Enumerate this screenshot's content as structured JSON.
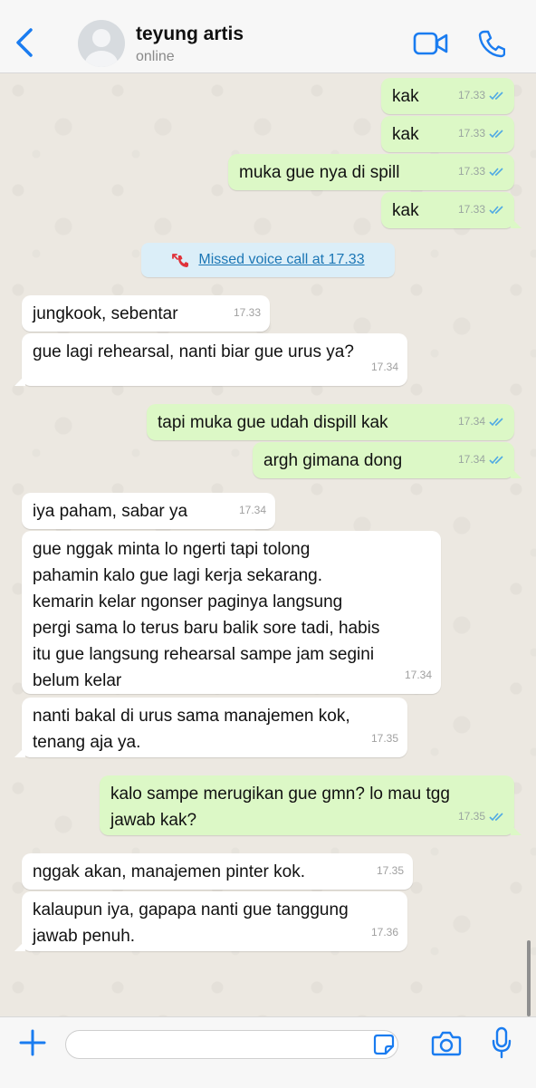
{
  "header": {
    "back_label": "Back",
    "contact_name": "teyung artis",
    "contact_status": "online"
  },
  "system_message": {
    "label": "Missed voice call at 17.33"
  },
  "messages": [
    {
      "dir": "out",
      "text": "kak",
      "time": "17.33"
    },
    {
      "dir": "out",
      "text": "kak",
      "time": "17.33"
    },
    {
      "dir": "out",
      "text": "muka gue nya di spill",
      "time": "17.33"
    },
    {
      "dir": "out",
      "text": "kak",
      "time": "17.33"
    },
    {
      "dir": "in",
      "text": "jungkook, sebentar",
      "time": "17.33"
    },
    {
      "dir": "in",
      "text": "gue lagi rehearsal, nanti biar gue urus ya?",
      "time": "17.34"
    },
    {
      "dir": "out",
      "text": "tapi muka gue udah dispill kak",
      "time": "17.34"
    },
    {
      "dir": "out",
      "text": "argh gimana dong",
      "time": "17.34"
    },
    {
      "dir": "in",
      "text": "iya paham, sabar ya",
      "time": "17.34"
    },
    {
      "dir": "in",
      "text": "gue nggak minta lo ngerti tapi tolong\npahamin kalo gue lagi kerja sekarang.\nkemarin kelar ngonser paginya langsung\npergi sama lo terus baru balik sore tadi, habis\nitu gue langsung rehearsal sampe jam segini\nbelum kelar",
      "time": "17.34"
    },
    {
      "dir": "in",
      "text": "nanti bakal di urus sama manajemen kok,\ntenang aja ya.",
      "time": "17.35"
    },
    {
      "dir": "out",
      "text": "kalo sampe merugikan gue gmn? lo mau tgg\njawab kak?",
      "time": "17.35"
    },
    {
      "dir": "in",
      "text": "nggak akan, manajemen pinter kok.",
      "time": "17.35"
    },
    {
      "dir": "in",
      "text": "kalaupun iya, gapapa nanti gue tanggung\njawab penuh.",
      "time": "17.36"
    }
  ],
  "composer": {
    "value": "",
    "placeholder": ""
  },
  "colors": {
    "accent": "#1a7cf0",
    "outgoing_bubble": "#dcf8c6",
    "incoming_bubble": "#ffffff",
    "read_ticks": "#4fa9e4"
  }
}
